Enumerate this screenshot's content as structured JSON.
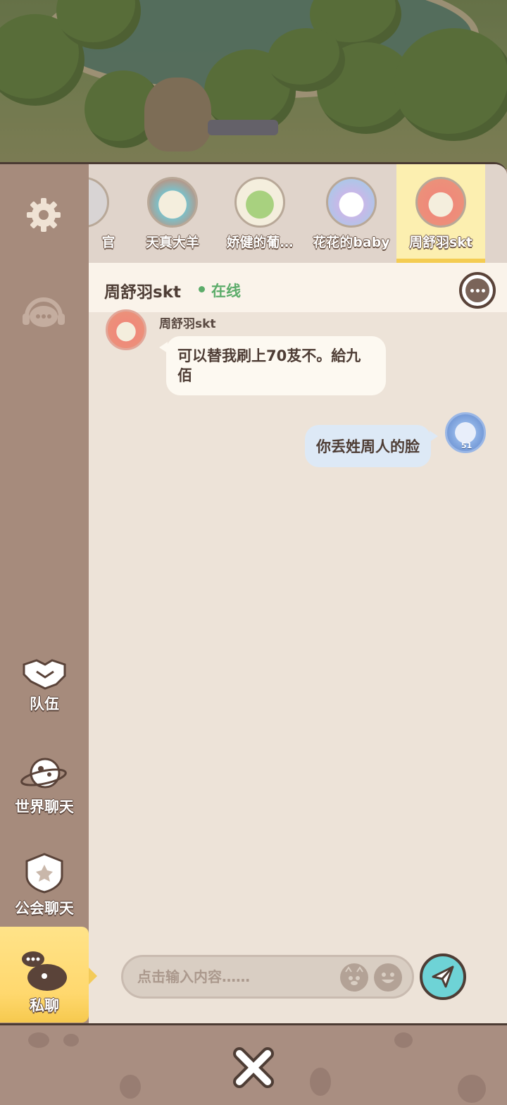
{
  "sidebar": {
    "settings_icon": "gear-icon",
    "support_icon": "headset-chat-icon",
    "team_label": "队伍",
    "world_chat_label": "世界聊天",
    "guild_chat_label": "公会聊天",
    "private_chat_label": "私聊"
  },
  "tabs": [
    {
      "name": "官"
    },
    {
      "name": "天真大羊"
    },
    {
      "name": "娇健的葡…"
    },
    {
      "name": "花花的baby"
    },
    {
      "name": "周舒羽skt"
    }
  ],
  "chat": {
    "title": "周舒羽skt",
    "status": "在线",
    "messages": [
      {
        "direction": "in",
        "sender": "周舒羽skt",
        "text": "可以替我刷上70芨不。給九佰"
      },
      {
        "direction": "out",
        "text": "你丢姓周人的脸"
      }
    ],
    "my_level": "51"
  },
  "input": {
    "placeholder": "点击输入内容……"
  },
  "colors": {
    "accent_yellow": "#ffd86e",
    "online_green": "#5cac6a",
    "send_teal": "#6ed3d6"
  }
}
